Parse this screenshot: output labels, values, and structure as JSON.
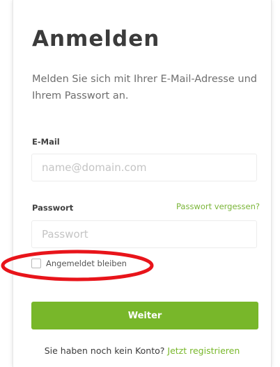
{
  "login": {
    "title": "Anmelden",
    "intro": "Melden Sie sich mit Ihrer E-Mail-Adresse und Ihrem Passwort an.",
    "email_label": "E-Mail",
    "email_placeholder": "name@domain.com",
    "email_value": "",
    "password_label": "Passwort",
    "forgot_link": "Passwort vergessen?",
    "password_placeholder": "Passwort",
    "password_value": "",
    "remember_label": "Angemeldet bleiben",
    "remember_checked": false,
    "submit_label": "Weiter",
    "signup_prompt": "Sie haben noch kein Konto?",
    "signup_link": "Jetzt registrieren"
  },
  "colors": {
    "accent": "#78b72a",
    "highlight": "#e8141a"
  }
}
